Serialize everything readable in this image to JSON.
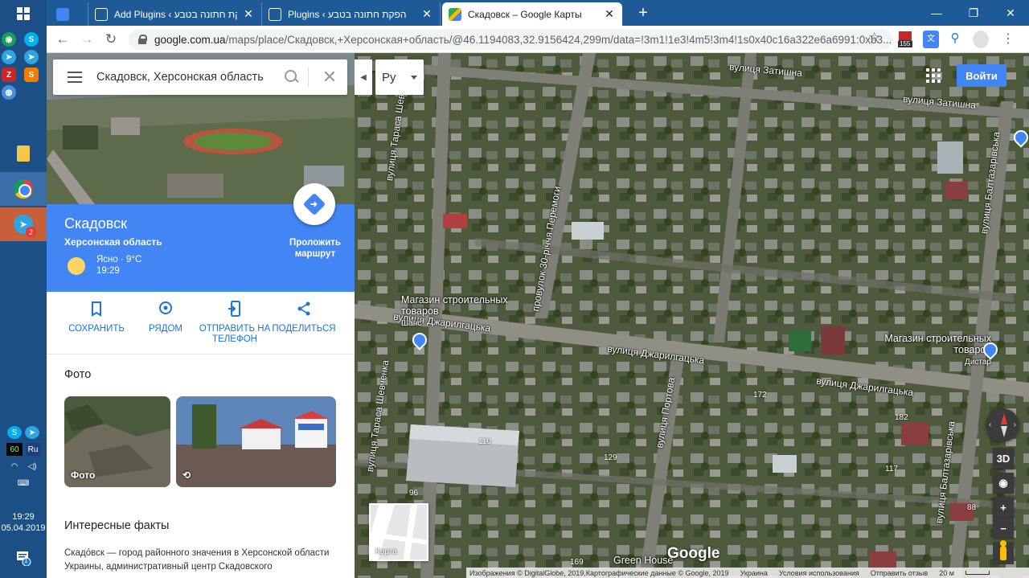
{
  "taskbar": {
    "clock_time": "19:29",
    "clock_date": "05.04.2019",
    "lang": "Ru",
    "net_speed": "60",
    "telegram_badge": "2",
    "notif_badge": "1"
  },
  "tabs": [
    {
      "title": "Add Plugins ‹ הפקת חתונה בטבע",
      "active": false
    },
    {
      "title": "Plugins ‹ הפקת חתונה בטבע",
      "active": false
    },
    {
      "title": "Скадовск – Google Карты",
      "active": true
    }
  ],
  "address": {
    "host": "google.com.ua",
    "path": "/maps/place/Скадовск,+Херсонская+область/@46.1194083,32.9156424,299m/data=!3m1!1e3!4m5!3m4!1s0x40c16a322e6a6991:0xb3..."
  },
  "extensions": {
    "badge": "155"
  },
  "search": {
    "value": "Скадовск, Херсонская область"
  },
  "place": {
    "title": "Скадовск",
    "region": "Херсонская область",
    "weather": "Ясно · 9°C",
    "time": "19:29",
    "route_label": "Проложить маршрут"
  },
  "actions": [
    {
      "label": "СОХРАНИТЬ",
      "icon": "bookmark-icon"
    },
    {
      "label": "РЯДОМ",
      "icon": "nearby-icon"
    },
    {
      "label": "ОТПРАВИТЬ НА ТЕЛЕФОН",
      "icon": "send-to-phone-icon"
    },
    {
      "label": "ПОДЕЛИТЬСЯ",
      "icon": "share-icon"
    }
  ],
  "photos": {
    "heading": "Фото",
    "items": [
      {
        "label": "Фото"
      },
      {
        "label": "360"
      }
    ]
  },
  "facts": {
    "heading": "Интересные факты",
    "text": "Скадо́вск — город районного значения в Херсонской области Украины, административный центр Скадовского"
  },
  "map": {
    "language": "Ру",
    "signin": "Войти",
    "tilt": "3D",
    "minimap_label": "Карта",
    "google_logo": "Google",
    "streets": {
      "zatishna_1": "вулиця Затишна",
      "zatishna_2": "вулиця Затишна",
      "dzharylgatska_1": "вулиця Джарилгацька",
      "dzharylgatska_2": "вулиця Джарилгацька",
      "dzharylgatska_3": "вулиця Джарилгацька",
      "shevchenka_1": "вулиця Тараса Шевченка",
      "shevchenka_2": "вулиця Тараса Шевченка",
      "peremohy": "провулок 30-річчя Перемоги",
      "portova": "вулиця Портова",
      "baltazarivska_1": "вулиця Балтазарівська",
      "baltazarivska_2": "вулиця Балтазарівська"
    },
    "pois": {
      "store_left": "Магазин строительных товаров",
      "store_left_sub": "Шанс",
      "store_right": "Магазин строительных товаров",
      "store_right_sub": "Дистар",
      "green_house": "Green House"
    },
    "house_numbers": [
      "172",
      "182",
      "110",
      "129",
      "117",
      "96",
      "169",
      "88"
    ],
    "attribution": {
      "imagery": "Изображения © DigitalGlobe, 2019,Картографические данные © Google, 2019",
      "country": "Украина",
      "terms": "Условия использования",
      "feedback": "Отправить отзыв",
      "scale": "20 м"
    }
  }
}
